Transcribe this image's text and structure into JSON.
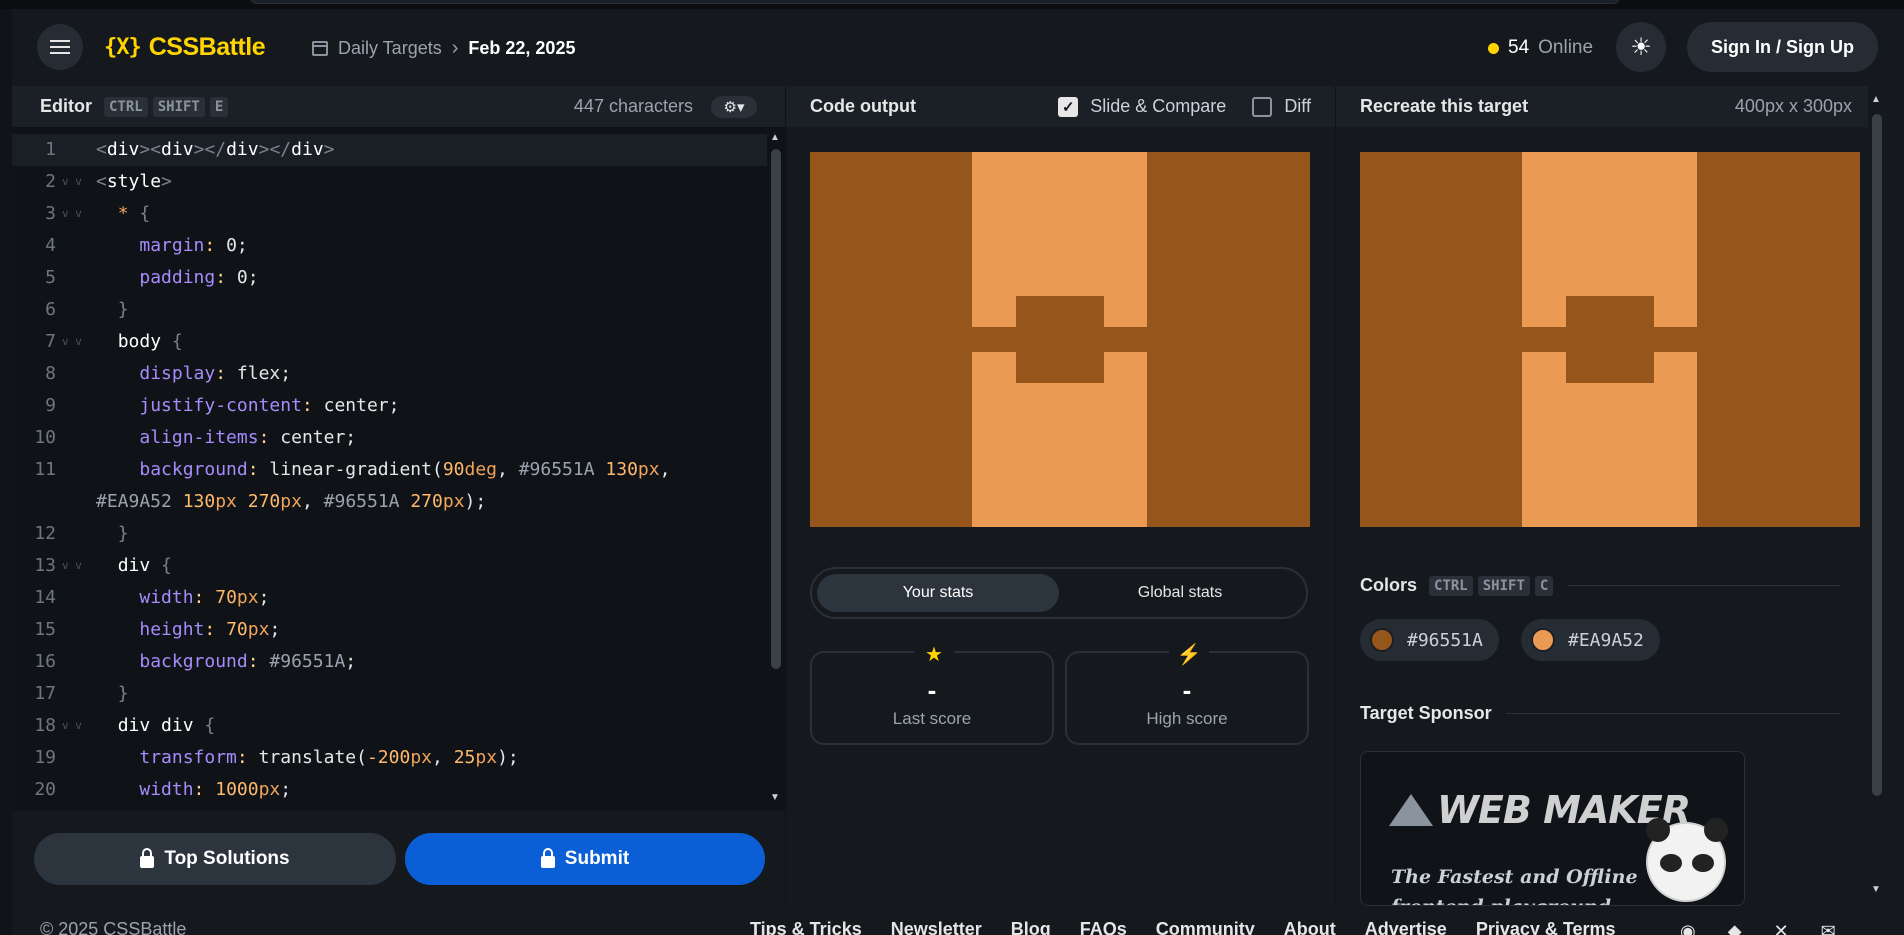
{
  "header": {
    "logo_mark": "{X}",
    "logo_text": "CSSBattle",
    "breadcrumb_link": "Daily Targets",
    "breadcrumb_sep": "›",
    "breadcrumb_current": "Feb 22, 2025",
    "online_count": "54",
    "online_label": "Online",
    "signin_label": "Sign In / Sign Up"
  },
  "editor": {
    "title": "Editor",
    "shortcut": [
      "CTRL",
      "SHIFT",
      "E"
    ],
    "char_count": "447 characters",
    "top_solutions_label": "Top Solutions",
    "submit_label": "Submit",
    "line_numbers": [
      "1",
      "2",
      "3",
      "4",
      "5",
      "6",
      "7",
      "8",
      "9",
      "10",
      "11",
      "",
      "12",
      "13",
      "14",
      "15",
      "16",
      "17",
      "18",
      "19",
      "20"
    ],
    "code_lines": [
      "<div><div></div></div>",
      "<style>",
      "  * {",
      "    margin: 0;",
      "    padding: 0;",
      "  }",
      "  body {",
      "    display: flex;",
      "    justify-content: center;",
      "    align-items: center;",
      "    background: linear-gradient(90deg, #96551A 130px,",
      "#EA9A52 130px 270px, #96551A 270px);",
      "  }",
      "  div {",
      "    width: 70px;",
      "    height: 70px;",
      "    background: #96551A;",
      "  }",
      "  div div {",
      "    transform: translate(-200px, 25px);",
      "    width: 1000px;"
    ]
  },
  "output": {
    "title": "Code output",
    "slide_compare_label": "Slide & Compare",
    "slide_compare_checked": true,
    "diff_label": "Diff",
    "diff_checked": false,
    "tab_your_stats": "Your stats",
    "tab_global_stats": "Global stats",
    "last_score_value": "-",
    "last_score_label": "Last score",
    "high_score_value": "-",
    "high_score_label": "High score"
  },
  "target": {
    "title": "Recreate this target",
    "dimensions": "400px x 300px",
    "colors_title": "Colors",
    "colors_shortcut": [
      "CTRL",
      "SHIFT",
      "C"
    ],
    "colors": [
      "#96551A",
      "#EA9A52"
    ],
    "sponsor_title": "Target Sponsor",
    "sponsor_logo_text": "WEB MAKER",
    "sponsor_tagline": "The Fastest and Offline frontend playground"
  },
  "footer": {
    "copyright": "© 2025 CSSBattle",
    "links": [
      "Tips & Tricks",
      "Newsletter",
      "Blog",
      "FAQs",
      "Community",
      "About",
      "Advertise",
      "Privacy & Terms"
    ]
  },
  "theme": {
    "accent": "#ffd400",
    "submit_blue": "#0b5fd6",
    "target_dark": "#96551A",
    "target_light": "#EA9A52"
  }
}
